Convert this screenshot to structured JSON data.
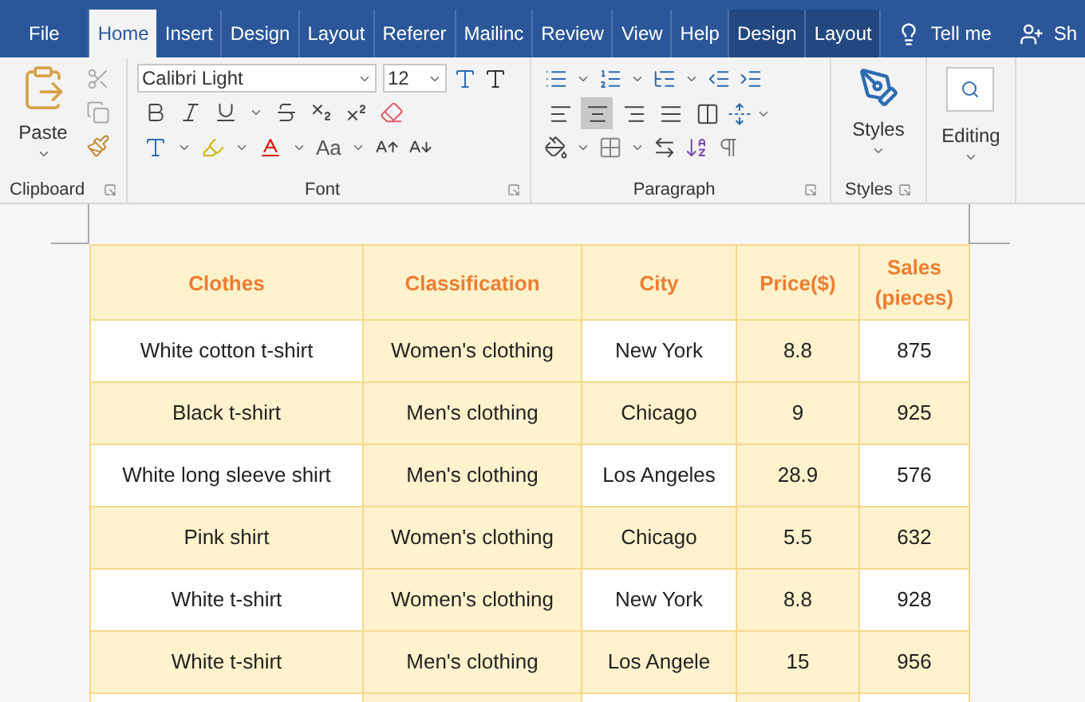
{
  "tabs": [
    {
      "label": "File",
      "selected": false,
      "contextual": false
    },
    {
      "label": "Home",
      "selected": true,
      "contextual": false
    },
    {
      "label": "Insert",
      "selected": false,
      "contextual": false
    },
    {
      "label": "Design",
      "selected": false,
      "contextual": false
    },
    {
      "label": "Layout",
      "selected": false,
      "contextual": false
    },
    {
      "label": "Referer",
      "selected": false,
      "contextual": false
    },
    {
      "label": "Mailinc",
      "selected": false,
      "contextual": false
    },
    {
      "label": "Review",
      "selected": false,
      "contextual": false
    },
    {
      "label": "View",
      "selected": false,
      "contextual": false
    },
    {
      "label": "Help",
      "selected": false,
      "contextual": false
    },
    {
      "label": "Design",
      "selected": false,
      "contextual": true
    },
    {
      "label": "Layout",
      "selected": false,
      "contextual": true
    }
  ],
  "tell_me": "Tell me",
  "share": "Sh",
  "ribbon": {
    "clipboard": {
      "paste": "Paste",
      "label": "Clipboard"
    },
    "font": {
      "name": "Calibri Light",
      "size": "12",
      "case_button": "Aa",
      "label": "Font"
    },
    "paragraph": {
      "label": "Paragraph",
      "alignment": [
        {
          "selected": false
        },
        {
          "selected": true
        },
        {
          "selected": false
        },
        {
          "selected": false
        },
        {
          "selected": false
        }
      ]
    },
    "styles": {
      "button": "Styles",
      "label": "Styles"
    },
    "editing": {
      "button": "Editing"
    }
  },
  "table": {
    "columns": [
      "Clothes",
      "Classification",
      "City",
      "Price($)",
      "Sales\n(pieces)"
    ],
    "rows": [
      [
        "White cotton t-shirt",
        "Women's clothing",
        "New York",
        "8.8",
        "875"
      ],
      [
        "Black t-shirt",
        "Men's clothing",
        "Chicago",
        "9",
        "925"
      ],
      [
        "White long sleeve shirt",
        "Men's clothing",
        "Los Angeles",
        "28.9",
        "576"
      ],
      [
        "Pink shirt",
        "Women's clothing",
        "Chicago",
        "5.5",
        "632"
      ],
      [
        "White t-shirt",
        "Women's clothing",
        "New York",
        "8.8",
        "928"
      ],
      [
        "White t-shirt",
        "Men's clothing",
        "Los Angele",
        "15",
        "956"
      ],
      [
        "",
        "",
        "",
        "",
        ""
      ]
    ]
  }
}
